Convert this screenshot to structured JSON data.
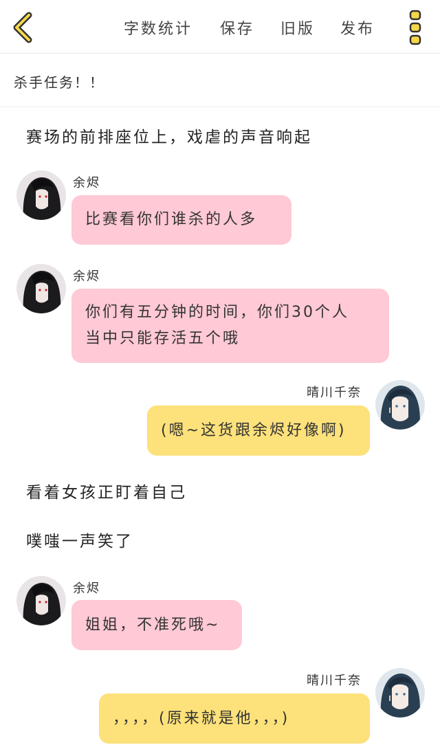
{
  "header": {
    "actions": [
      "字数统计",
      "保存",
      "旧版",
      "发布"
    ]
  },
  "chapter_title": "杀手任务！！",
  "narration": [
    "赛场的前排座位上，戏虐的声音响起",
    "看着女孩正盯着自己",
    "噗嗤一声笑了"
  ],
  "messages": [
    {
      "speaker": "余烬",
      "side": "left",
      "text": "比赛看你们谁杀的人多"
    },
    {
      "speaker": "余烬",
      "side": "left",
      "lines": [
        "你们有五分钟的时间，你们30个人",
        "当中只能存活五个哦"
      ]
    },
    {
      "speaker": "晴川千奈",
      "side": "right",
      "text": "(嗯~这货跟余烬好像啊)"
    },
    {
      "speaker": "余烬",
      "side": "left",
      "text": "姐姐，不准死哦~"
    },
    {
      "speaker": "晴川千奈",
      "side": "right",
      "text": "，，，，(原来就是他，，，)"
    }
  ],
  "colors": {
    "left_bubble": "#ffc9d6",
    "right_bubble": "#fde17a",
    "accent_icon": "#f5d74a"
  },
  "icons": {
    "back": "chevron-left-icon",
    "menu": "vertical-dots-menu-icon"
  }
}
